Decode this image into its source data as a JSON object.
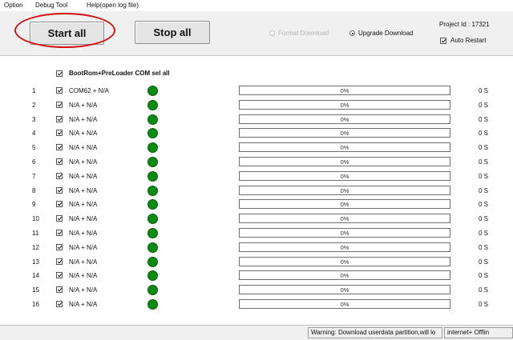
{
  "menu": {
    "items": [
      "Option",
      "Debug Tool",
      "Help(open log file)"
    ]
  },
  "toolbar": {
    "start_label": "Start all",
    "stop_label": "Stop all",
    "format_download_label": "Format Download",
    "upgrade_download_label": "Upgrade Download",
    "selected_mode": "Upgrade Download",
    "project_id_label": "Project Id : 17321",
    "auto_restart_label": "Auto Restart",
    "auto_restart_checked": true
  },
  "select_all": {
    "label": "BootRom+PreLoader COM sel all",
    "checked": true
  },
  "rows": [
    {
      "index": "1",
      "port": "COM62 + N/A",
      "progress_text": "0%",
      "progress": 0,
      "time": "0 S",
      "checked": true,
      "led_color": "#0c8a12"
    },
    {
      "index": "2",
      "port": "N/A + N/A",
      "progress_text": "0%",
      "progress": 0,
      "time": "0 S",
      "checked": true,
      "led_color": "#0c8a12"
    },
    {
      "index": "3",
      "port": "N/A + N/A",
      "progress_text": "0%",
      "progress": 0,
      "time": "0 S",
      "checked": true,
      "led_color": "#0c8a12"
    },
    {
      "index": "4",
      "port": "N/A + N/A",
      "progress_text": "0%",
      "progress": 0,
      "time": "0 S",
      "checked": true,
      "led_color": "#0c8a12"
    },
    {
      "index": "5",
      "port": "N/A + N/A",
      "progress_text": "0%",
      "progress": 0,
      "time": "0 S",
      "checked": true,
      "led_color": "#0c8a12"
    },
    {
      "index": "6",
      "port": "N/A + N/A",
      "progress_text": "0%",
      "progress": 0,
      "time": "0 S",
      "checked": true,
      "led_color": "#0c8a12"
    },
    {
      "index": "7",
      "port": "N/A + N/A",
      "progress_text": "0%",
      "progress": 0,
      "time": "0 S",
      "checked": true,
      "led_color": "#0c8a12"
    },
    {
      "index": "8",
      "port": "N/A + N/A",
      "progress_text": "0%",
      "progress": 0,
      "time": "0 S",
      "checked": true,
      "led_color": "#0c8a12"
    },
    {
      "index": "9",
      "port": "N/A + N/A",
      "progress_text": "0%",
      "progress": 0,
      "time": "0 S",
      "checked": true,
      "led_color": "#0c8a12"
    },
    {
      "index": "10",
      "port": "N/A + N/A",
      "progress_text": "0%",
      "progress": 0,
      "time": "0 S",
      "checked": true,
      "led_color": "#0c8a12"
    },
    {
      "index": "11",
      "port": "N/A + N/A",
      "progress_text": "0%",
      "progress": 0,
      "time": "0 S",
      "checked": true,
      "led_color": "#0c8a12"
    },
    {
      "index": "12",
      "port": "N/A + N/A",
      "progress_text": "0%",
      "progress": 0,
      "time": "0 S",
      "checked": true,
      "led_color": "#0c8a12"
    },
    {
      "index": "13",
      "port": "N/A + N/A",
      "progress_text": "0%",
      "progress": 0,
      "time": "0 S",
      "checked": true,
      "led_color": "#0c8a12"
    },
    {
      "index": "14",
      "port": "N/A + N/A",
      "progress_text": "0%",
      "progress": 0,
      "time": "0 S",
      "checked": true,
      "led_color": "#0c8a12"
    },
    {
      "index": "15",
      "port": "N/A + N/A",
      "progress_text": "0%",
      "progress": 0,
      "time": "0 S",
      "checked": true,
      "led_color": "#0c8a12"
    },
    {
      "index": "16",
      "port": "N/A + N/A",
      "progress_text": "0%",
      "progress": 0,
      "time": "0 S",
      "checked": true,
      "led_color": "#0c8a12"
    }
  ],
  "status": {
    "warning": "Warning: Download userdata partition,will lo",
    "network": "internet+ Offlin"
  },
  "colors": {
    "annotation_ring": "#d11010",
    "led_green": "#0c8a12",
    "toolbar_bg": "#f0f0f0"
  }
}
